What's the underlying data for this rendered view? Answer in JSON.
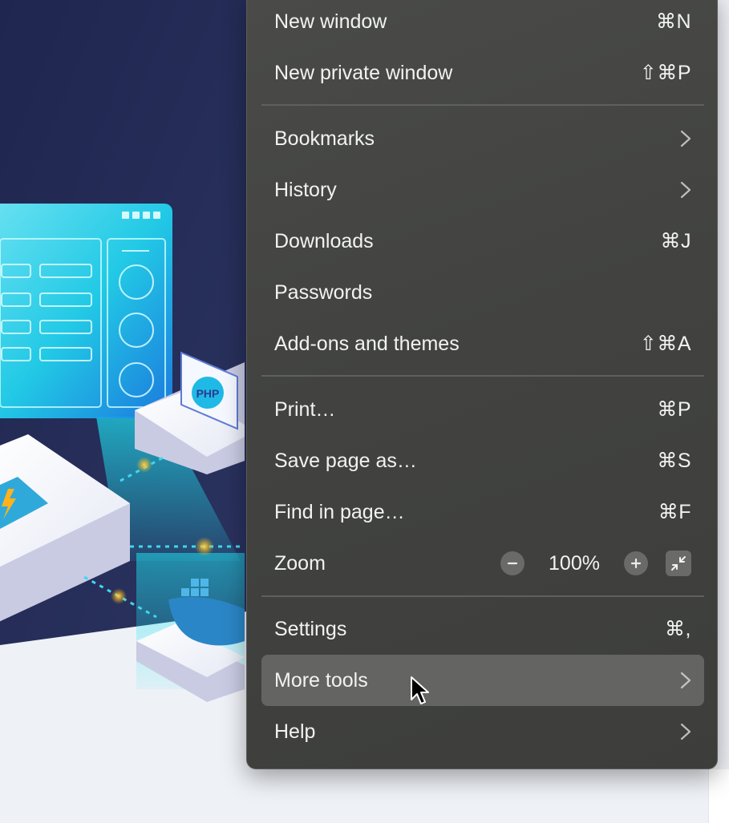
{
  "menu": {
    "sections": [
      [
        {
          "label": "New window",
          "shortcut": "⌘N",
          "icon": null
        },
        {
          "label": "New private window",
          "shortcut": "⇧⌘P",
          "icon": null
        }
      ],
      [
        {
          "label": "Bookmarks",
          "shortcut": null,
          "icon": "chevron-right-icon"
        },
        {
          "label": "History",
          "shortcut": null,
          "icon": "chevron-right-icon"
        },
        {
          "label": "Downloads",
          "shortcut": "⌘J",
          "icon": null
        },
        {
          "label": "Passwords",
          "shortcut": null,
          "icon": null
        },
        {
          "label": "Add-ons and themes",
          "shortcut": "⇧⌘A",
          "icon": null
        }
      ],
      [
        {
          "label": "Print…",
          "shortcut": "⌘P",
          "icon": null
        },
        {
          "label": "Save page as…",
          "shortcut": "⌘S",
          "icon": null
        },
        {
          "label": "Find in page…",
          "shortcut": "⌘F",
          "icon": null
        }
      ]
    ],
    "zoom": {
      "label": "Zoom",
      "value": "100%",
      "decrease_icon": "minus-icon",
      "increase_icon": "plus-icon",
      "fullscreen_icon": "fullscreen-icon"
    },
    "footer": [
      {
        "label": "Settings",
        "shortcut": "⌘,",
        "icon": null
      },
      {
        "label": "More tools",
        "shortcut": null,
        "icon": "chevron-right-icon",
        "hovered": true
      },
      {
        "label": "Help",
        "shortcut": null,
        "icon": "chevron-right-icon"
      }
    ]
  },
  "background_illustration": {
    "badge_text": "PHP",
    "icons": [
      "php-gear-icon",
      "lightning-icon",
      "docker-whale-icon"
    ]
  },
  "colors": {
    "menu_background": "#434442",
    "menu_hover": "#646563",
    "menu_text": "#f2f2f2",
    "page_background": "#eef1f6",
    "illustration_navy": "#232b4f",
    "illustration_cyan": "#19e1f0"
  }
}
